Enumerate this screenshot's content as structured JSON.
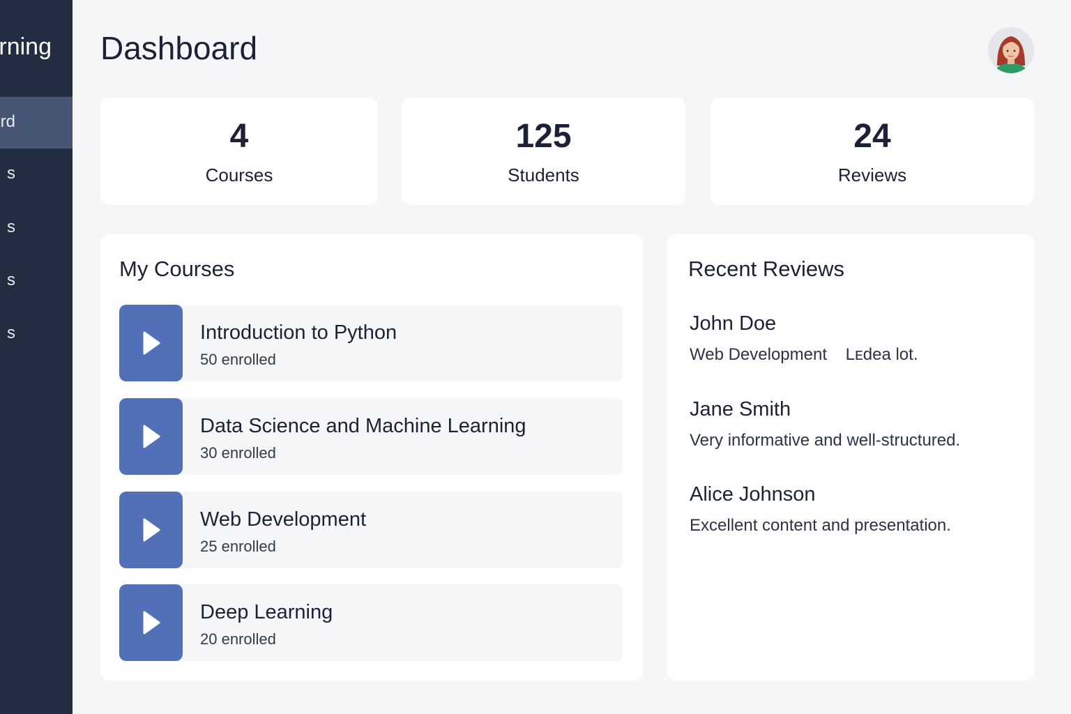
{
  "sidebar": {
    "brand_visible": "rning",
    "items": [
      {
        "label_visible": "rd",
        "active": true
      },
      {
        "label_visible": "s",
        "active": false
      },
      {
        "label_visible": "s",
        "active": false
      },
      {
        "label_visible": "s",
        "active": false
      },
      {
        "label_visible": "s",
        "active": false
      }
    ]
  },
  "header": {
    "title": "Dashboard",
    "avatar_icon": "user-avatar-icon"
  },
  "stats": [
    {
      "value": "4",
      "label": "Courses"
    },
    {
      "value": "125",
      "label": "Students"
    },
    {
      "value": "24",
      "label": "Reviews"
    }
  ],
  "courses": {
    "heading": "My Courses",
    "items": [
      {
        "title": "Introduction to Python",
        "enrolled": "50 enrolled",
        "icon": "play-icon"
      },
      {
        "title": "Data Science and Machine Learning",
        "enrolled": "30 enrolled",
        "icon": "play-icon"
      },
      {
        "title": "Web Development",
        "enrolled": "25 enrolled",
        "icon": "play-icon"
      },
      {
        "title": "Deep Learning",
        "enrolled": "20 enrolled",
        "icon": "play-icon"
      }
    ]
  },
  "reviews": {
    "heading": "Recent Reviews",
    "items": [
      {
        "name": "John Doe",
        "text": "Web Development    Lᴇdea lot."
      },
      {
        "name": "Jane Smith",
        "text": "Very informative and well-structured."
      },
      {
        "name": "Alice Johnson",
        "text": "Excellent content and presentation."
      }
    ]
  },
  "colors": {
    "sidebar_bg": "#222d41",
    "sidebar_active": "#455573",
    "accent": "#5270b8",
    "page_bg": "#f5f6f8",
    "card_bg": "#ffffff",
    "text": "#1b2236"
  }
}
